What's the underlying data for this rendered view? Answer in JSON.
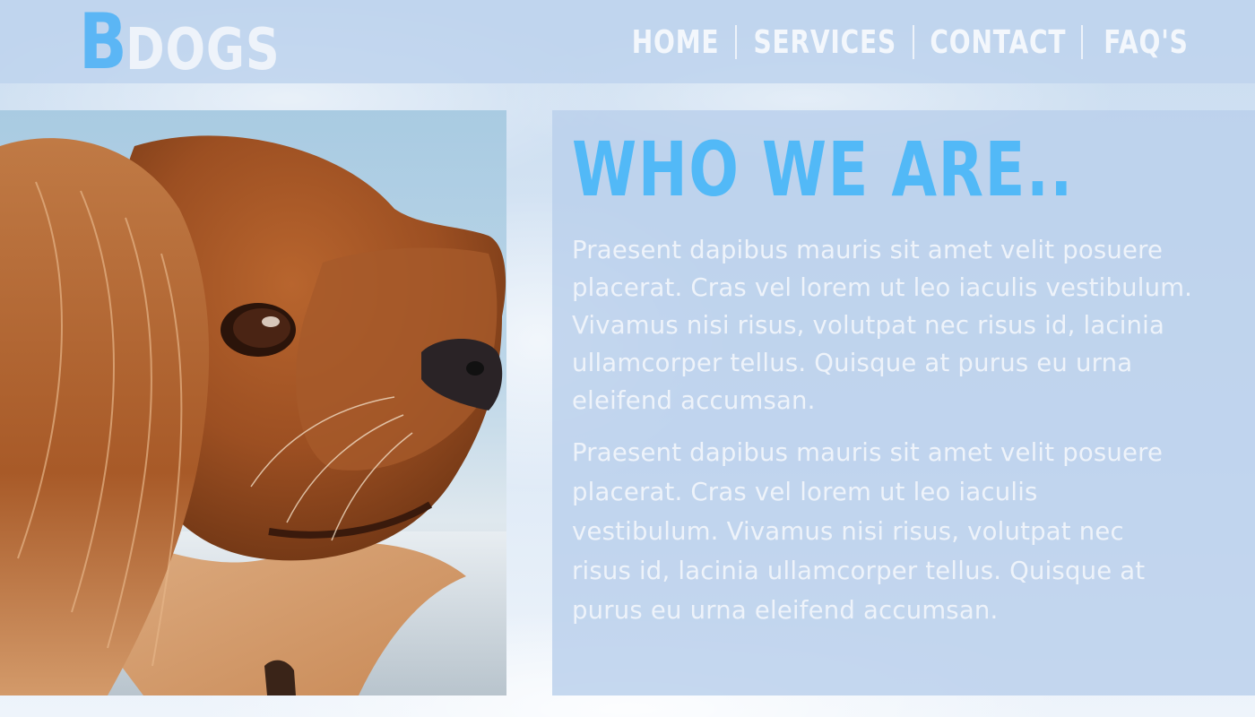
{
  "header": {
    "logo": {
      "initial": "B",
      "rest": "DOGS"
    },
    "nav": [
      {
        "label": "HOME"
      },
      {
        "label": "SERVICES"
      },
      {
        "label": "CONTACT"
      },
      {
        "label": "FAQ'S"
      }
    ],
    "separator": "|"
  },
  "hero_image": {
    "subject": "dog-photo"
  },
  "about": {
    "heading": "WHO WE ARE..",
    "paragraphs": [
      "Praesent dapibus mauris sit amet velit posuere placerat. Cras vel lorem ut leo iaculis vestibulum. Vivamus nisi risus, volutpat nec risus id, lacinia ullamcorper tellus. Quisque at purus eu urna eleifend accumsan.",
      "Praesent dapibus mauris sit amet velit posuere placerat. Cras vel lorem ut leo iaculis vestibulum. Vivamus nisi risus, volutpat nec risus id, lacinia ullamcorper tellus. Quisque at purus eu urna eleifend accumsan."
    ]
  },
  "colors": {
    "accent": "#52b9f7",
    "header_bg": "#bed4ed",
    "panel_bg": "#bad0eb",
    "text_light": "#eef3fa"
  }
}
